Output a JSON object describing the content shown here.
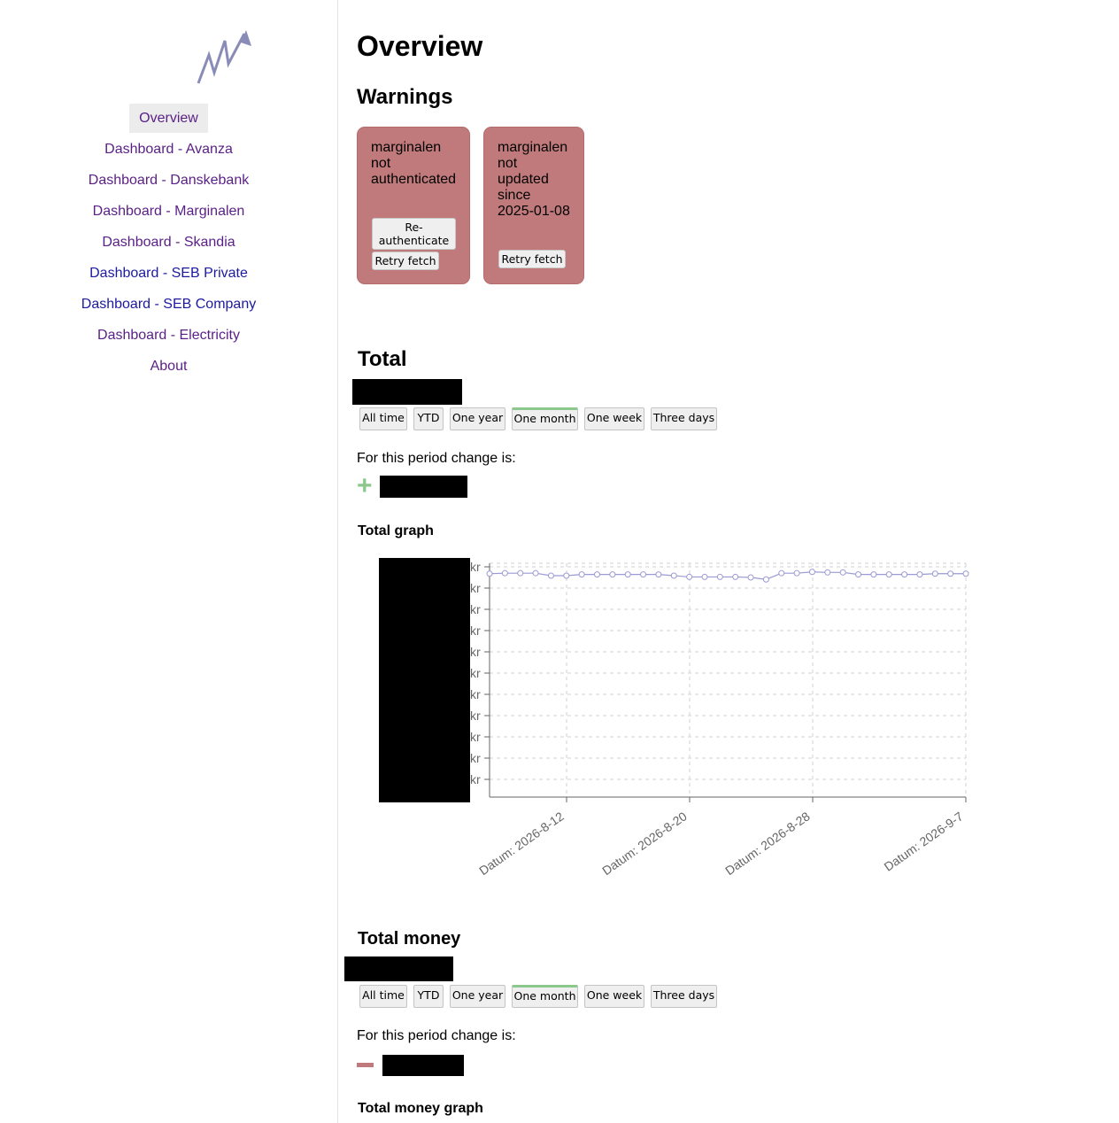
{
  "sidebar": {
    "items": [
      {
        "label": "Overview"
      },
      {
        "label": "Dashboard - Avanza"
      },
      {
        "label": "Dashboard - Danskebank"
      },
      {
        "label": "Dashboard - Marginalen"
      },
      {
        "label": "Dashboard - Skandia"
      },
      {
        "label": "Dashboard - SEB Private"
      },
      {
        "label": "Dashboard - SEB Company"
      },
      {
        "label": "Dashboard - Electricity"
      },
      {
        "label": "About"
      }
    ],
    "active_item": "Overview"
  },
  "page": {
    "title": "Overview",
    "warnings_heading": "Warnings"
  },
  "warnings": [
    {
      "lines": [
        "marginalen",
        "not",
        "authenticated"
      ],
      "reauth_label": "Re-authenticate",
      "retry_label": "Retry fetch"
    },
    {
      "lines": [
        "marginalen",
        "not",
        "updated",
        "since",
        "2025-01-08"
      ],
      "retry_label": "Retry fetch"
    }
  ],
  "periods": [
    "All time",
    "YTD",
    "One year",
    "One month",
    "One week",
    "Three days"
  ],
  "active_period": "One month",
  "total": {
    "heading": "Total",
    "change_text": "For this period change is:",
    "change_sign": "+",
    "graph_heading": "Total graph"
  },
  "total_money": {
    "heading": "Total money",
    "change_text": "For this period change is:",
    "change_sign": "-",
    "graph_heading": "Total money graph"
  },
  "chart_data": {
    "type": "line",
    "title": "Total graph",
    "x_tick_labels": [
      "Datum: 2026-8-12",
      "Datum: 2026-8-20",
      "Datum: 2026-8-28",
      "Datum: 2026-9-7"
    ],
    "y_tick_labels": [
      "kr",
      "kr",
      "kr",
      "kr",
      "kr",
      "kr",
      "kr",
      "kr",
      "kr",
      "kr",
      "kr"
    ],
    "y_values_hidden": true,
    "grid": true,
    "line_color": "#9a9ad4",
    "series": [
      {
        "values": [
          0.893,
          0.895,
          0.895,
          0.895,
          0.885,
          0.885,
          0.89,
          0.89,
          0.89,
          0.89,
          0.89,
          0.89,
          0.885,
          0.88,
          0.88,
          0.88,
          0.88,
          0.878,
          0.87,
          0.895,
          0.895,
          0.9,
          0.898,
          0.898,
          0.89,
          0.89,
          0.89,
          0.89,
          0.89,
          0.893,
          0.893,
          0.893
        ]
      }
    ]
  },
  "colors": {
    "warning_bg": "#c07a7b",
    "positive": "#8cc88c",
    "negative": "#c07a7b",
    "active_period": "#8cc88c"
  }
}
